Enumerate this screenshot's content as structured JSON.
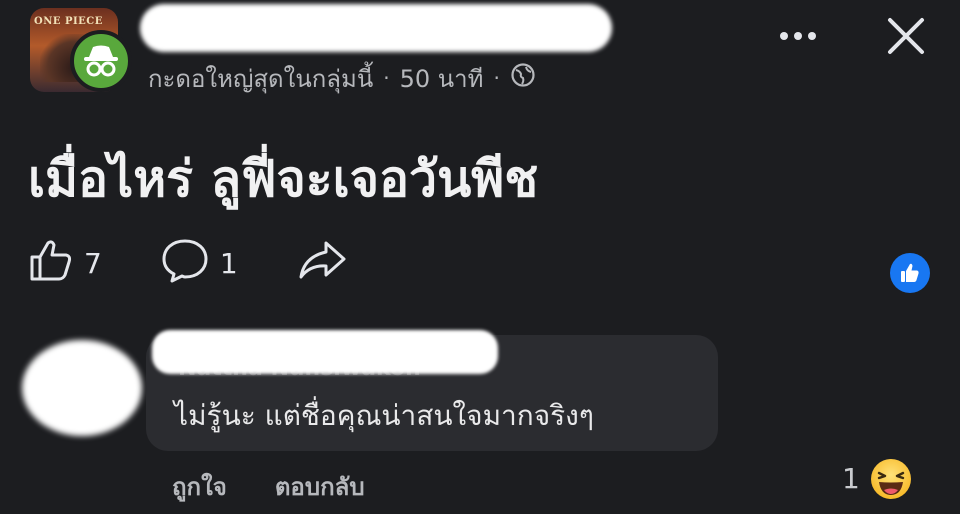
{
  "header": {
    "group_logo_text": "ONE PIECE",
    "meta": {
      "badge_text": "กะดอใหญ่สุดในกลุ่มนี้",
      "separator": "·",
      "time": "50 นาที",
      "privacy_icon": "globe-icon"
    },
    "more_icon": "more-dots-icon",
    "close_icon": "close-icon"
  },
  "post": {
    "text": "เมื่อไหร่ ลูฟี่จะเจอวันพีช",
    "like_count": "7",
    "comment_count": "1",
    "icons": {
      "like": "thumbs-up-icon",
      "comment": "comment-bubble-icon",
      "share": "share-arrow-icon"
    }
  },
  "comment": {
    "author": "Nattha Nuhsiwakon",
    "text": "ไม่รู้นะ แต่ชื่อคุณน่าสนใจมากจริงๆ",
    "like_label": "ถูกใจ",
    "reply_label": "ตอบกลับ",
    "reaction_count": "1",
    "reaction_icon": "haha-emoji-icon"
  },
  "colors": {
    "background": "#1c1d20",
    "bubble": "#2b2c30",
    "anon_badge": "#59a83c",
    "like_blue": "#1877f2",
    "muted_text": "#b6b8bc"
  }
}
